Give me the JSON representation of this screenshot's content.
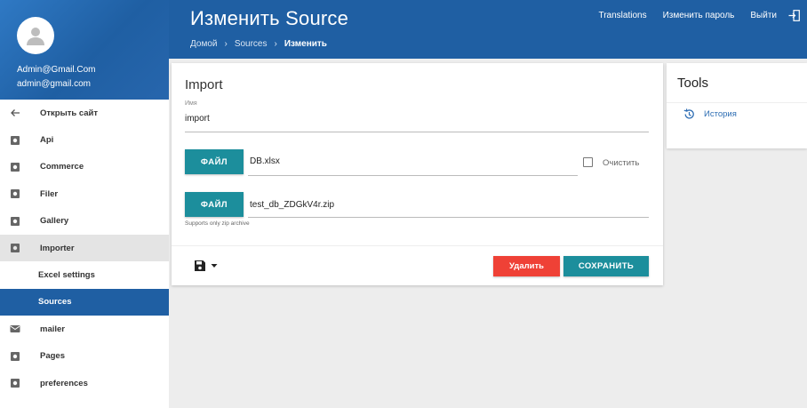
{
  "header": {
    "title": "Изменить Source",
    "breadcrumb": [
      "Домой",
      "Sources",
      "Изменить"
    ],
    "nav": [
      "Translations",
      "Изменить пароль",
      "Выйти"
    ]
  },
  "sidebar": {
    "user_name": "Admin@Gmail.Com",
    "user_email": "admin@gmail.com",
    "items": [
      {
        "label": "Открыть сайт",
        "icon": "arrow-left-icon"
      },
      {
        "label": "Api",
        "icon": "gear-icon"
      },
      {
        "label": "Commerce",
        "icon": "gear-icon"
      },
      {
        "label": "Filer",
        "icon": "gear-icon"
      },
      {
        "label": "Gallery",
        "icon": "gear-icon"
      },
      {
        "label": "Importer",
        "icon": "gear-icon"
      },
      {
        "label": "Excel settings"
      },
      {
        "label": "Sources"
      },
      {
        "label": "mailer",
        "icon": "mail-icon"
      },
      {
        "label": "Pages",
        "icon": "gear-icon"
      },
      {
        "label": "preferences",
        "icon": "gear-icon"
      }
    ]
  },
  "form": {
    "title": "Import",
    "name_label": "Имя",
    "name_value": "import",
    "file1_button": "ФАЙЛ",
    "file1_value": "DB.xlsx",
    "clear_label": "Очистить",
    "file2_button": "ФАЙЛ",
    "file2_value": "test_db_ZDGkV4r.zip",
    "file2_hint": "Supports only zip archive",
    "delete_label": "Удалить",
    "save_label": "СОХРАНИТЬ"
  },
  "tools": {
    "title": "Tools",
    "history_label": "История"
  },
  "colors": {
    "primary": "#1f5fa3",
    "teal": "#1c8e9c",
    "danger": "#ef4136"
  }
}
